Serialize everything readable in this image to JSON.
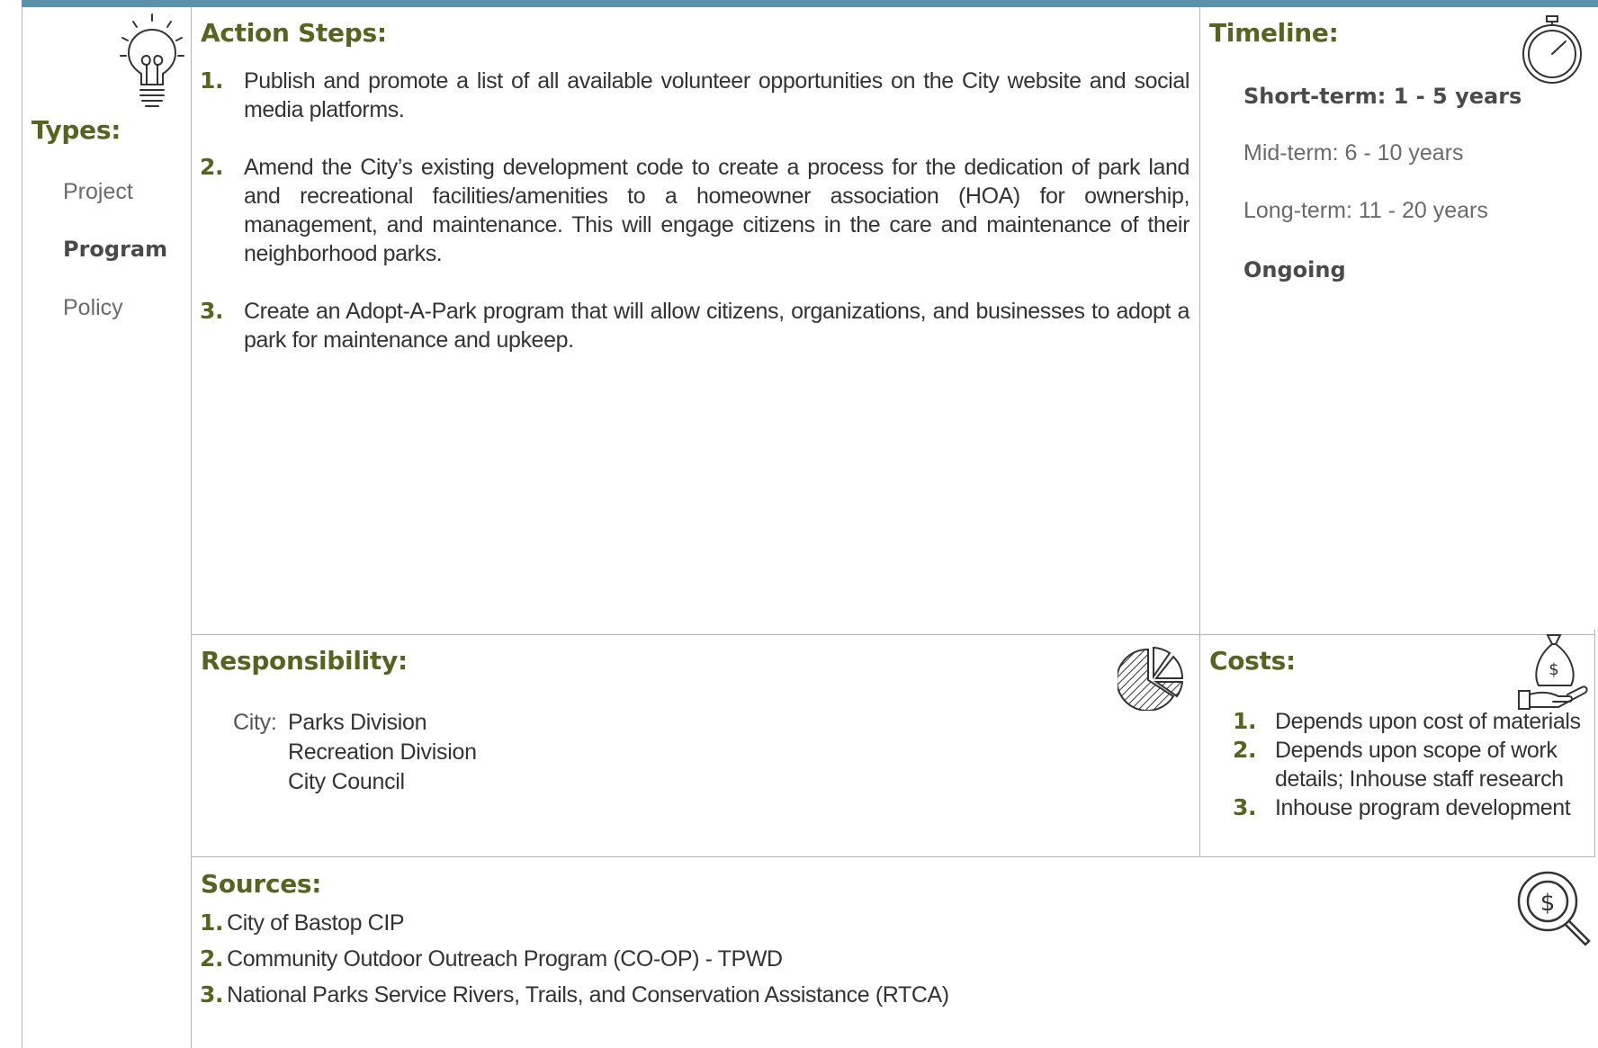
{
  "types": {
    "heading": "Types:",
    "items": [
      "Project",
      "Program",
      "Policy"
    ]
  },
  "action_steps": {
    "heading": "Action Steps:",
    "items": [
      {
        "num": "1.",
        "text": "Publish and promote a list of all available volunteer opportunities on the City website and social media platforms."
      },
      {
        "num": "2.",
        "text": "Amend the City’s existing development code to create a process for the dedication of park land and recreational facilities/amenities to a homeowner association (HOA) for ownership, management, and maintenance. This will engage citizens in the care and maintenance of their neighborhood parks."
      },
      {
        "num": "3.",
        "text": "Create an Adopt-A-Park program that will allow citizens, organizations, and businesses to adopt a park for maintenance and upkeep."
      }
    ]
  },
  "timeline": {
    "heading": "Timeline:",
    "short": "Short-term:  1 - 5 years",
    "mid": "Mid-term:  6 - 10 years",
    "long": "Long-term:  11 - 20 years",
    "ongoing": "Ongoing"
  },
  "responsibility": {
    "heading": "Responsibility:",
    "label": "City:",
    "entries": [
      "Parks Division",
      "Recreation Division",
      "City Council"
    ]
  },
  "costs": {
    "heading": "Costs:",
    "items": [
      {
        "num": "1.",
        "text": "Depends upon cost of materials"
      },
      {
        "num": "2.",
        "text": "Depends upon scope of work details; Inhouse staff research"
      },
      {
        "num": "3.",
        "text": "Inhouse program development"
      }
    ]
  },
  "sources": {
    "heading": "Sources:",
    "items": [
      {
        "num": "1.",
        "text": "City of Bastop CIP"
      },
      {
        "num": "2.",
        "text": "Community Outdoor Outreach Program (CO-OP) - TPWD"
      },
      {
        "num": "3.",
        "text": "National Parks Service Rivers, Trails, and Conservation Assistance (RTCA)"
      }
    ]
  },
  "icons": {
    "types": "lightbulb-icon",
    "timeline": "stopwatch-icon",
    "responsibility": "pie-chart-icon",
    "costs": "money-bag-hand-icon",
    "sources": "dollar-magnifier-icon"
  },
  "colors": {
    "heading": "#56641f",
    "top_bar": "#5b92a8",
    "rule": "#b5b5b5"
  }
}
